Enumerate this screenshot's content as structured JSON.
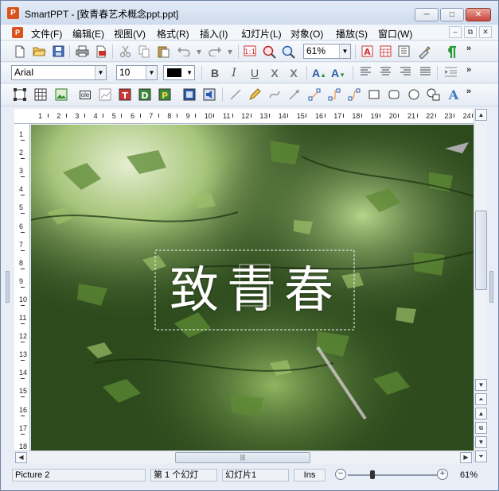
{
  "app": {
    "icon_letter": "P",
    "title": "SmartPPT - [致青春艺术概念ppt.ppt]"
  },
  "window_controls": {
    "minimize": "─",
    "maximize": "□",
    "close": "✕"
  },
  "menu": {
    "items": [
      "文件(F)",
      "编辑(E)",
      "视图(V)",
      "格式(R)",
      "插入(I)",
      "幻灯片(L)",
      "对象(O)",
      "播放(S)",
      "窗口(W)"
    ],
    "mdi_controls": {
      "minimize": "–",
      "restore": "⧉",
      "close": "✕"
    }
  },
  "toolbar1": {
    "zoom_value": "61%",
    "overflow": "»"
  },
  "toolbar2": {
    "font_name": "Arial",
    "font_size": "10",
    "font_color": "#000000",
    "overflow": "»"
  },
  "toolbar3": {
    "overflow": "»"
  },
  "ruler": {
    "h_numbers": [
      "1",
      "2",
      "3",
      "4",
      "5",
      "6",
      "7",
      "8",
      "9",
      "10",
      "11",
      "12",
      "13",
      "14",
      "15",
      "16",
      "17",
      "18",
      "19",
      "20",
      "21",
      "22",
      "23",
      "24"
    ],
    "v_numbers": [
      "1",
      "2",
      "3",
      "4",
      "5",
      "6",
      "7",
      "8",
      "9",
      "10",
      "11",
      "12",
      "13",
      "14",
      "15",
      "16",
      "17",
      "18"
    ]
  },
  "slide": {
    "title_text": "致青春",
    "background_colors": {
      "dark": "#2c4a1c",
      "mid": "#4f7a2d",
      "light": "#a9c97a",
      "sky": "#dfe9c8"
    }
  },
  "status": {
    "object": "Picture 2",
    "slide_index": "第 1 个幻灯",
    "slide_name": "幻灯片1",
    "mode": "Ins",
    "zoom": "61%",
    "zoom_level": 0.61
  }
}
